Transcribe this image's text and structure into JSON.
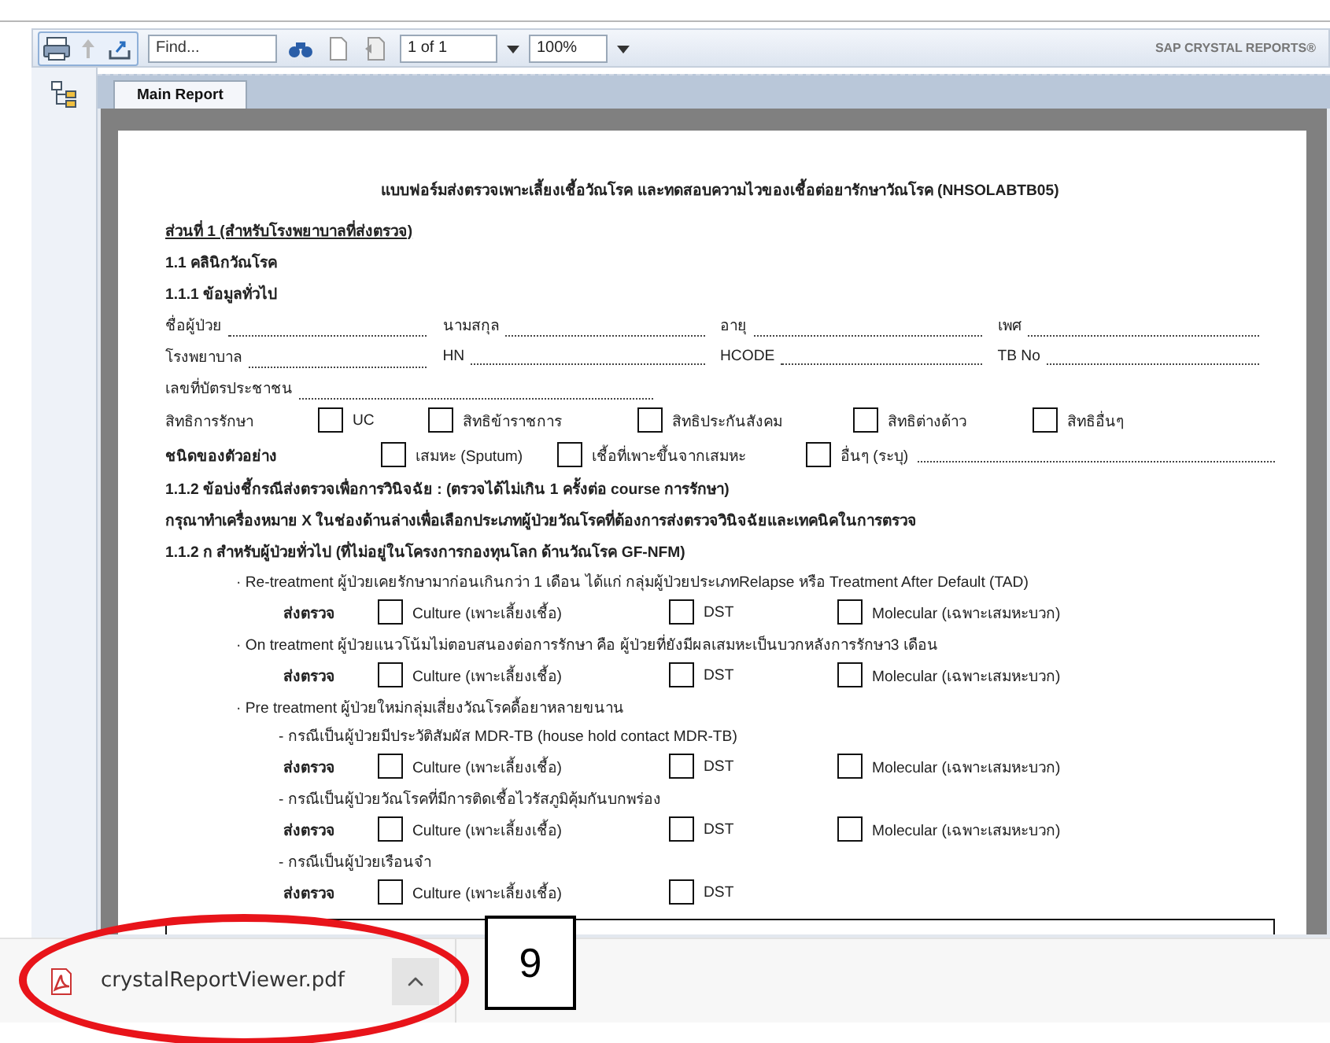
{
  "toolbar": {
    "find": {
      "placeholder": "Find..."
    },
    "page": "1 of 1",
    "zoom": "100%",
    "brand": "SAP CRYSTAL REPORTS®"
  },
  "tabs": [
    {
      "label": "Main Report",
      "selected": true
    }
  ],
  "report": {
    "title": "แบบฟอร์มส่งตรวจเพาะเลี้ยงเชื้อวัณโรค และทดสอบความไวของเชื้อต่อยารักษาวัณโรค (NHSOLABTB05)",
    "lines": [
      {
        "kind": "section",
        "text": "ส่วนที่ 1 (สำหรับโรงพยาบาลที่ส่งตรวจ)"
      },
      {
        "kind": "heading",
        "text": "1.1 คลินิกวัณโรค"
      },
      {
        "kind": "heading",
        "text": "1.1.1 ข้อมูลทั่วไป"
      },
      {
        "kind": "fields",
        "fields": [
          "ชื่อผู้ป่วย",
          "นามสกุล",
          "อายุ",
          "เพศ"
        ]
      },
      {
        "kind": "fields",
        "fields": [
          "โรงพยาบาล",
          "HN",
          "HCODE",
          "TB No"
        ]
      },
      {
        "kind": "fields",
        "fields": [
          "เลขที่บัตรประชาชน"
        ]
      },
      {
        "kind": "choices",
        "label": "สิทธิการรักษา",
        "bold": false,
        "options": [
          {
            "text": "UC",
            "checked": false
          },
          {
            "text": "สิทธิข้าราชการ",
            "checked": false
          },
          {
            "text": "สิทธิประกันสังคม",
            "checked": false
          },
          {
            "text": "สิทธิต่างด้าว",
            "checked": false
          },
          {
            "text": "สิทธิอื่นๆ",
            "checked": false
          }
        ]
      },
      {
        "kind": "choices",
        "label": "ชนิดของตัวอย่าง",
        "bold": true,
        "options": [
          {
            "text": "เสมหะ (Sputum)",
            "checked": false
          },
          {
            "text": "เชื้อที่เพาะขึ้นจากเสมหะ",
            "checked": false
          },
          {
            "text": "อื่นๆ (ระบุ)",
            "checked": false,
            "fill": true
          }
        ]
      },
      {
        "kind": "heading",
        "text": "1.1.2 ข้อบ่งชี้กรณีส่งตรวจเพื่อการวินิจฉัย : (ตรวจได้ไม่เกิน 1 ครั้งต่อ course การรักษา)"
      },
      {
        "kind": "heading",
        "text": "กรุณาทำเครื่องหมาย X ในช่องด้านล่างเพื่อเลือกประเภทผู้ป่วยวัณโรคที่ต้องการส่งตรวจวินิจฉัยและเทคนิคในการตรวจ"
      },
      {
        "kind": "heading",
        "text": "1.1.2 ก สำหรับผู้ป่วยทั่วไป (ที่ไม่อยู่ในโครงการกองทุนโลก ด้านวัณโรค GF-NFM)"
      },
      {
        "kind": "item",
        "text": "· Re-treatment ผู้ป่วยเคยรักษามาก่อนเกินกว่า 1 เดือน ได้แก่ กลุ่มผู้ป่วยประเภทRelapse หรือ Treatment After Default (TAD)"
      },
      {
        "kind": "tests",
        "label": "ส่งตรวจ",
        "options": [
          {
            "text": "Culture (เพาะเลี้ยงเชื้อ)",
            "checked": false
          },
          {
            "text": "DST",
            "checked": false
          },
          {
            "text": "Molecular (เฉพาะเสมหะบวก)",
            "checked": false
          }
        ]
      },
      {
        "kind": "item",
        "text": "· On treatment ผู้ป่วยแนวโน้มไม่ตอบสนองต่อการรักษา คือ ผู้ป่วยที่ยังมีผลเสมหะเป็นบวกหลังการรักษา3 เดือน"
      },
      {
        "kind": "tests",
        "label": "ส่งตรวจ",
        "options": [
          {
            "text": "Culture (เพาะเลี้ยงเชื้อ)",
            "checked": false
          },
          {
            "text": "DST",
            "checked": false
          },
          {
            "text": "Molecular (เฉพาะเสมหะบวก)",
            "checked": false
          }
        ]
      },
      {
        "kind": "item",
        "text": "· Pre treatment ผู้ป่วยใหม่กลุ่มเสี่ยงวัณโรคดื้อยาหลายขนาน"
      },
      {
        "kind": "subitem",
        "text": "- กรณีเป็นผู้ป่วยมีประวัติสัมผัส MDR-TB (house hold contact MDR-TB)"
      },
      {
        "kind": "tests",
        "label": "ส่งตรวจ",
        "options": [
          {
            "text": "Culture (เพาะเลี้ยงเชื้อ)",
            "checked": false
          },
          {
            "text": "DST",
            "checked": false
          },
          {
            "text": "Molecular (เฉพาะเสมหะบวก)",
            "checked": false
          }
        ]
      },
      {
        "kind": "subitem",
        "text": "- กรณีเป็นผู้ป่วยวัณโรคที่มีการติดเชื้อไวรัสภูมิคุ้มกันบกพร่อง"
      },
      {
        "kind": "tests",
        "label": "ส่งตรวจ",
        "options": [
          {
            "text": "Culture (เพาะเลี้ยงเชื้อ)",
            "checked": false
          },
          {
            "text": "DST",
            "checked": false
          },
          {
            "text": "Molecular (เฉพาะเสมหะบวก)",
            "checked": false
          }
        ]
      },
      {
        "kind": "subitem",
        "text": "- กรณีเป็นผู้ป่วยเรือนจำ"
      },
      {
        "kind": "tests",
        "label": "ส่งตรวจ",
        "options": [
          {
            "text": "Culture (เพาะเลี้ยงเชื้อ)",
            "checked": false
          },
          {
            "text": "DST",
            "checked": false
          }
        ]
      }
    ]
  },
  "download": {
    "filename": "crystalReportViewer.pdf"
  },
  "annotation": {
    "label": "9"
  }
}
